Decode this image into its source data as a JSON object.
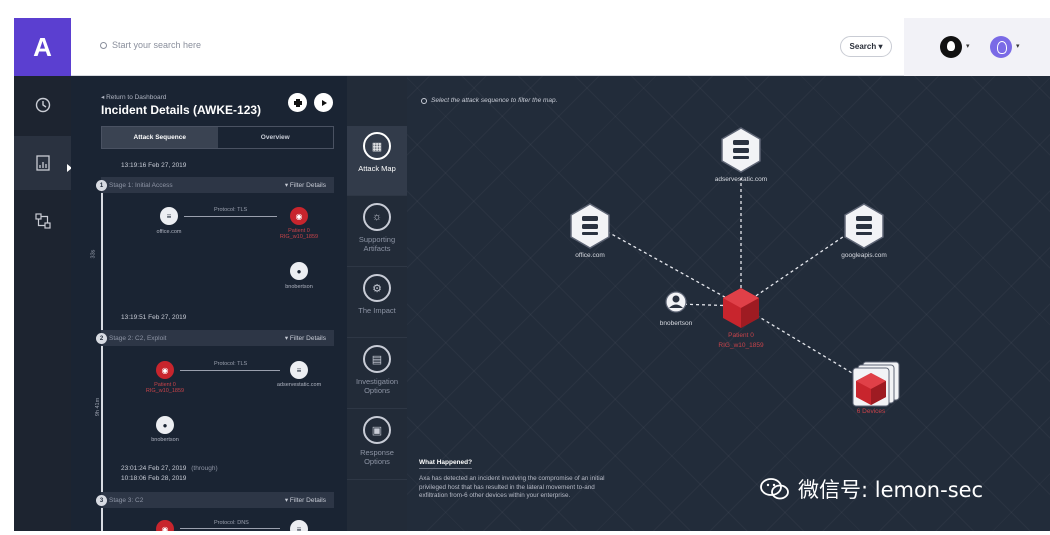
{
  "app": {
    "logo_letter": "A",
    "accent": "#5b3fd0",
    "danger": "#c8252d"
  },
  "topbar": {
    "search_placeholder": "Start your search here",
    "search_button": "Search ▾"
  },
  "nav": {
    "items": [
      "clock-icon",
      "report-icon",
      "network-icon"
    ],
    "active_index": 1
  },
  "incident": {
    "back_link": "◂ Return to Dashboard",
    "title": "Incident Details (AWKE-123)",
    "tabs": [
      {
        "label": "Attack Sequence",
        "active": true
      },
      {
        "label": "Overview",
        "active": false
      }
    ],
    "filter_label": "▾ Filter Details",
    "stages": [
      {
        "num": "1",
        "timestamp": "13:19:16 Feb 27, 2019",
        "label": "Stage 1: Initial Access",
        "protocol": "Protocol: TLS",
        "source": "office.com",
        "target": "Patient 0\nRIG_w10_1859",
        "user": "bnobertson",
        "duration": "33s"
      },
      {
        "num": "2",
        "timestamp": "13:19:51 Feb 27, 2019",
        "label": "Stage 2: C2, Exploit",
        "protocol": "Protocol: TLS",
        "source": "Patient 0\nRIG_w10_1859",
        "target": "adservestatic.com",
        "user": "bnobertson",
        "duration": "9h 41m"
      },
      {
        "num": "3",
        "timestamp": "23:01:24 Feb 27, 2019",
        "timestamp_extra": "(through)",
        "timestamp2": "10:18:06 Feb 28, 2019",
        "label": "Stage 3: C2",
        "protocol": "Protocol: DNS"
      }
    ]
  },
  "strip": {
    "items": [
      {
        "label": "Attack Map",
        "icon": "map-icon",
        "active": true
      },
      {
        "label": "Supporting Artifacts",
        "icon": "fingerprint-icon",
        "active": false
      },
      {
        "label": "The Impact",
        "icon": "impact-icon",
        "active": false
      },
      {
        "label": "Investigation Options",
        "icon": "investigation-icon",
        "active": false
      },
      {
        "label": "Response Options",
        "icon": "response-icon",
        "active": false
      }
    ]
  },
  "map": {
    "hint": "Select the attack sequence to filter the map.",
    "nodes": {
      "top": "adservestatic.com",
      "left": "office.com",
      "right": "googleapis.com",
      "user": "bnobertson",
      "center": "Patient 0",
      "center_sub": "RIG_w10_1859",
      "devices": "6 Devices"
    },
    "what_happened_title": "What Happened?",
    "what_happened_body": "Axa has detected an incident involving the compromise of an initial privileged host that has resulted in the lateral movement to-and exfiltration from-6 other devices within your enterprise."
  },
  "watermark": "微信号: lemon-sec"
}
